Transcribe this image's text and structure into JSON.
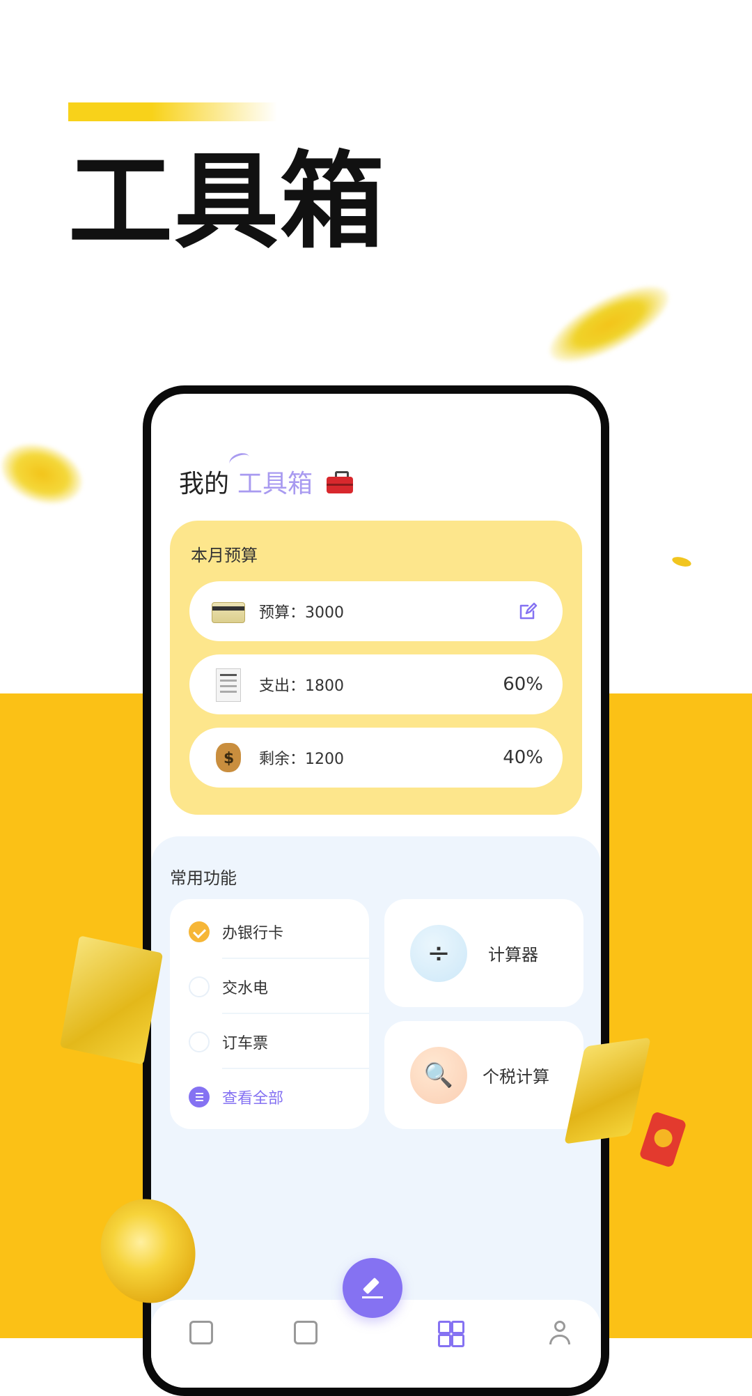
{
  "poster": {
    "title": "工具箱",
    "colors": {
      "yellow_bg": "#FBC116",
      "accent_bar": "#F8D21A",
      "purple": "#8572F2"
    }
  },
  "phone": {
    "heading": {
      "prefix": "我的",
      "highlight": "工具箱",
      "icon": "toolbox-icon"
    },
    "budget": {
      "title": "本月预算",
      "rows": [
        {
          "icon": "credit-card-icon",
          "label": "预算：3000",
          "action_icon": "edit-icon"
        },
        {
          "icon": "receipt-icon",
          "label": "支出：1800",
          "percent": "60%"
        },
        {
          "icon": "money-bag-icon",
          "label": "剩余：1200",
          "percent": "40%"
        }
      ]
    },
    "common": {
      "title": "常用功能",
      "todos": [
        {
          "label": "办银行卡",
          "checked": true
        },
        {
          "label": "交水电",
          "checked": false
        },
        {
          "label": "订车票",
          "checked": false
        }
      ],
      "view_all": "查看全部",
      "tools": [
        {
          "icon": "÷",
          "name": "计算器"
        },
        {
          "icon": "🔍",
          "name": "个税计算"
        }
      ]
    },
    "tabbar": {
      "items": [
        "calendar-icon",
        "chart-icon",
        "grid-icon",
        "user-icon"
      ],
      "active": "grid-icon"
    }
  }
}
